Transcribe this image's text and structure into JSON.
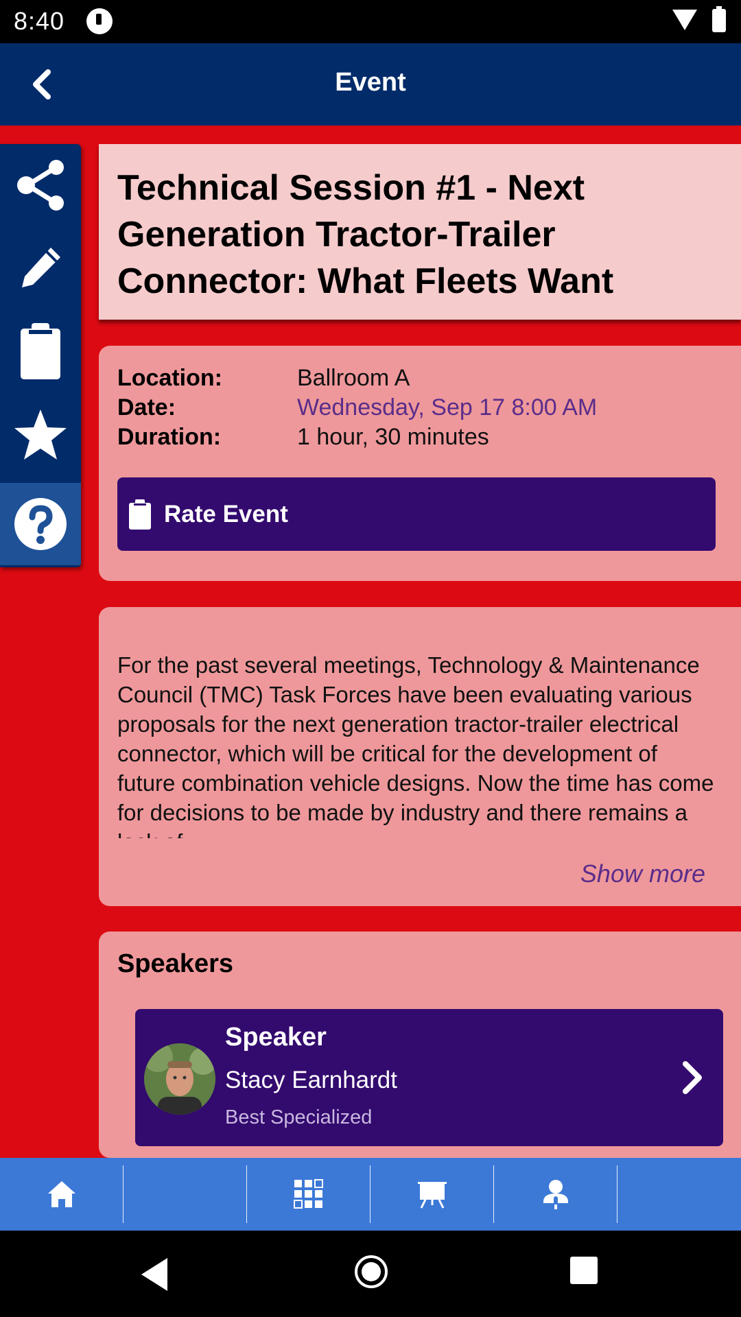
{
  "status_bar": {
    "time": "8:40",
    "icons": [
      "notification-icon",
      "wifi-icon",
      "battery-icon"
    ]
  },
  "app_bar": {
    "title": "Event",
    "back_icon": "chevron-left-icon"
  },
  "side_rail": {
    "items": [
      {
        "icon": "share-icon",
        "active": false
      },
      {
        "icon": "pencil-icon",
        "active": false
      },
      {
        "icon": "clipboard-icon",
        "active": false
      },
      {
        "icon": "star-icon",
        "active": false
      },
      {
        "icon": "help-icon",
        "active": true
      }
    ]
  },
  "event": {
    "title": "Technical Session #1 - Next Generation Tractor-Trailer Connector: What Fleets Want",
    "location_label": "Location:",
    "location": "Ballroom A",
    "date_label": "Date:",
    "date": "Wednesday, Sep 17 8:00 AM",
    "duration_label": "Duration:",
    "duration": "1 hour, 30 minutes",
    "rate_button_label": "Rate Event",
    "description": "For the past several meetings, Technology & Maintenance Council (TMC) Task Forces have been evaluating various proposals for the next generation tractor-trailer electrical connector, which will be critical for the development of future combination vehicle designs. Now the time has come for decisions to be made by industry and there remains a lack of",
    "show_more_label": "Show more"
  },
  "speakers": {
    "heading": "Speakers",
    "items": [
      {
        "role": "Speaker",
        "name": "Stacy Earnhardt",
        "organization": "Best Specialized"
      }
    ]
  },
  "tab_bar": {
    "tabs": [
      {
        "icon": "home-icon"
      },
      {
        "icon": ""
      },
      {
        "icon": "grid-icon"
      },
      {
        "icon": "presentation-icon"
      },
      {
        "icon": "speaker-icon"
      }
    ]
  },
  "colors": {
    "background": "#dc0a12",
    "app_bar": "#022b6a",
    "title_card": "#f6cbcc",
    "card": "#ef989b",
    "button": "#330a6e",
    "accent_text": "#5a2d8a",
    "tab_bar": "#3c79d7"
  }
}
